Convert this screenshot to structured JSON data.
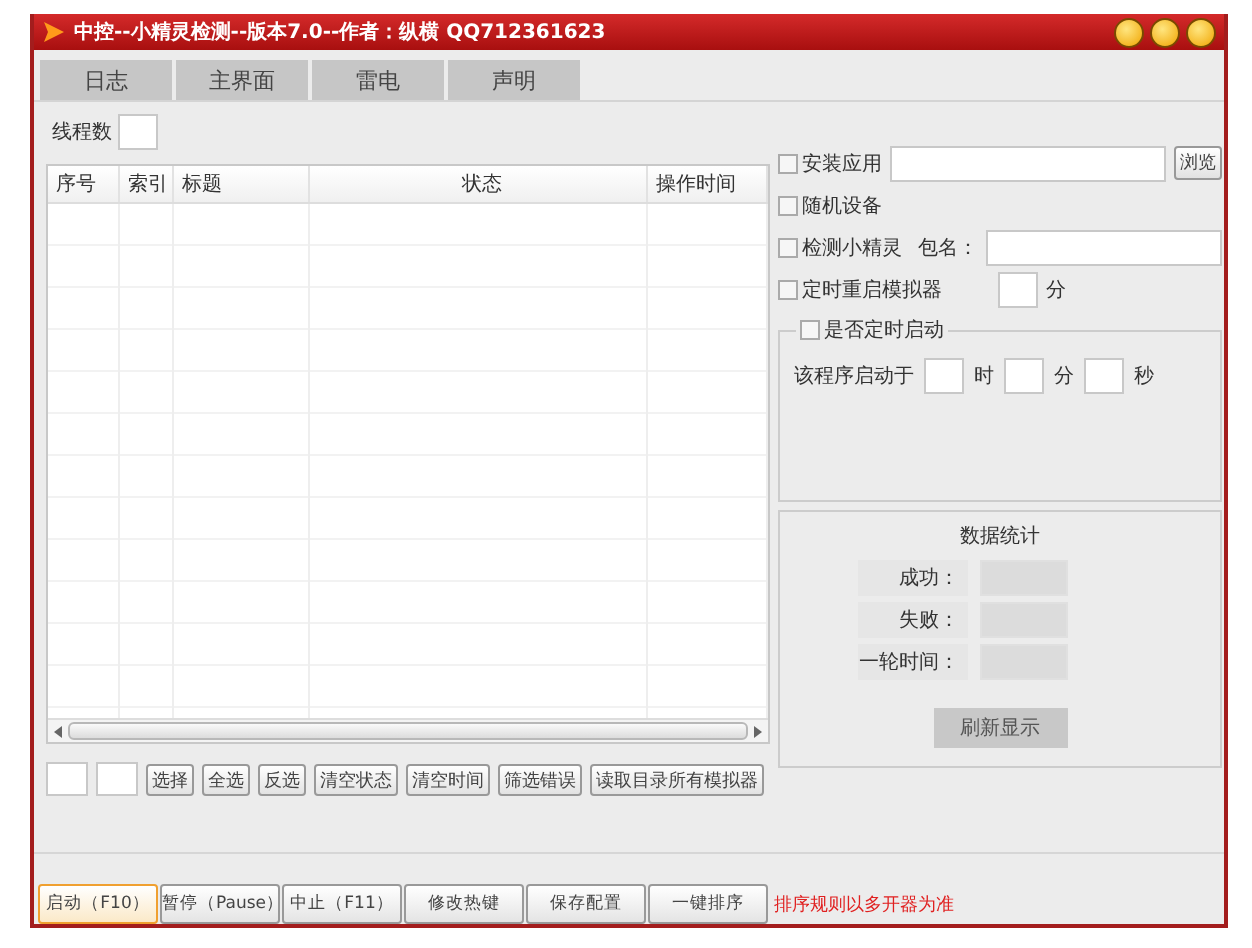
{
  "window": {
    "title": "中控--小精灵检测--版本7.0--作者：纵横 QQ712361623"
  },
  "tabs": [
    {
      "label": "日志",
      "selected": false
    },
    {
      "label": "主界面",
      "selected": false
    },
    {
      "label": "雷电",
      "selected": false
    },
    {
      "label": "声明",
      "selected": false
    }
  ],
  "thread_count": {
    "label": "线程数"
  },
  "table": {
    "columns": [
      "序号",
      "索引",
      "标题",
      "状态",
      "操作时间"
    ]
  },
  "list_buttons": [
    "选择",
    "全选",
    "反选",
    "清空状态",
    "清空时间",
    "筛选错误",
    "读取目录所有模拟器"
  ],
  "options": [
    {
      "kind": "file",
      "label": "安装应用",
      "checked": false,
      "button": "浏览"
    },
    {
      "kind": "plain",
      "label": "随机设备",
      "checked": false
    },
    {
      "kind": "field",
      "label": "检测小精灵",
      "checked": false,
      "field_label": "包名："
    },
    {
      "kind": "minutes",
      "label": "定时重启模拟器",
      "checked": false,
      "unit": "分"
    }
  ],
  "timer": {
    "label": "是否定时启动",
    "checked": false,
    "prefix": "该程序启动于",
    "units": [
      "时",
      "分",
      "秒"
    ]
  },
  "stats": {
    "title": "数据统计",
    "rows": [
      "成功：",
      "失败：",
      "一轮时间："
    ],
    "button": "刷新显示"
  },
  "actions": [
    {
      "label": "启动（F10）",
      "selected": true
    },
    {
      "label": "暂停（Pause）",
      "selected": false
    },
    {
      "label": "中止（F11）",
      "selected": false
    },
    {
      "label": "修改热键",
      "selected": false
    },
    {
      "label": "保存配置",
      "selected": false
    },
    {
      "label": "一键排序",
      "selected": false
    }
  ],
  "note": "排序规则以多开器为准"
}
